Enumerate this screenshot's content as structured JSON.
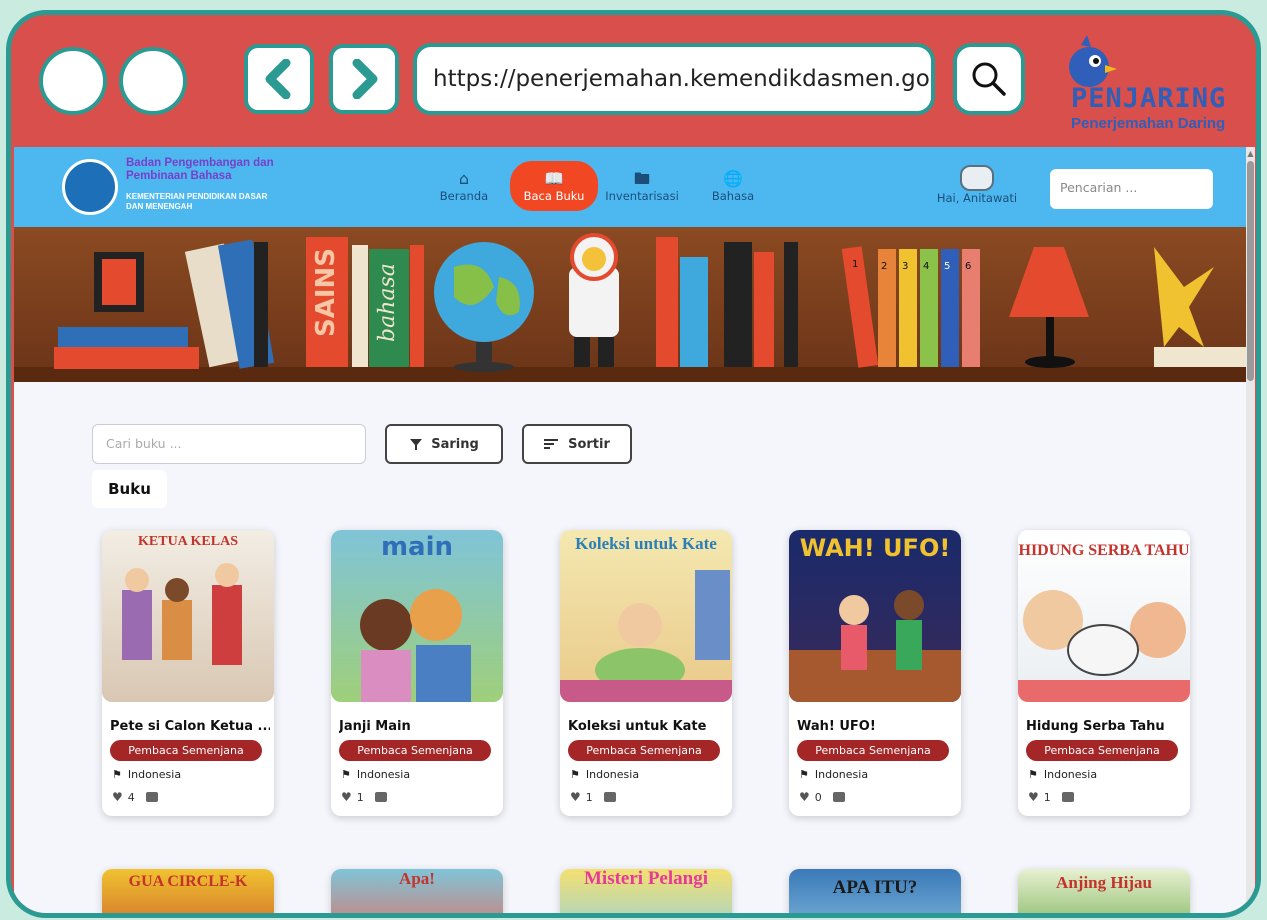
{
  "browser": {
    "url": "https://penerjemahan.kemendikdasmen.go.id/",
    "logo_title": "PENJARING",
    "logo_subtitle": "Penerjemahan Daring"
  },
  "site": {
    "org_line1": "Badan Pengembangan dan Pembinaan Bahasa",
    "org_line2": "KEMENTERIAN PENDIDIKAN DASAR DAN MENENGAH",
    "nav": [
      {
        "label": "Beranda",
        "icon": "home-icon"
      },
      {
        "label": "Baca Buku",
        "icon": "book-open-icon"
      },
      {
        "label": "Inventarisasi",
        "icon": "folder-icon"
      },
      {
        "label": "Bahasa",
        "icon": "globe-icon"
      }
    ],
    "greeting": "Hai, Anitawati",
    "search_placeholder": "Pencarian ..."
  },
  "catalog": {
    "search_placeholder": "Cari buku ...",
    "filter_label": "Saring",
    "sort_label": "Sortir",
    "tab_label": "Buku",
    "books": [
      {
        "title": "Pete si Calon Ketua ...",
        "level": "Pembaca Semenjana",
        "language": "Indonesia",
        "likes": "4",
        "cover_text": "KETUA KELAS"
      },
      {
        "title": "Janji Main",
        "level": "Pembaca Semenjana",
        "language": "Indonesia",
        "likes": "1",
        "cover_text": "main"
      },
      {
        "title": "Koleksi untuk Kate",
        "level": "Pembaca Semenjana",
        "language": "Indonesia",
        "likes": "1",
        "cover_text": "Koleksi untuk Kate"
      },
      {
        "title": "Wah! UFO!",
        "level": "Pembaca Semenjana",
        "language": "Indonesia",
        "likes": "0",
        "cover_text": "WAH! UFO!"
      },
      {
        "title": "Hidung Serba Tahu",
        "level": "Pembaca Semenjana",
        "language": "Indonesia",
        "likes": "1",
        "cover_text": "HIDUNG SERBA TAHU"
      }
    ],
    "next_row_covers": [
      {
        "cover_text": "GUA CIRCLE-K"
      },
      {
        "cover_text": "Apa!"
      },
      {
        "cover_text": "Misteri Pelangi"
      },
      {
        "cover_text": "APA ITU?"
      },
      {
        "cover_text": "Anjing Hijau"
      }
    ]
  },
  "banner_labels": {
    "book1": "SAINS",
    "book2": "bahasa",
    "numbers": [
      "1",
      "2",
      "3",
      "4",
      "5",
      "6"
    ]
  },
  "colors": {
    "frame": "#d94f4c",
    "border": "#2a9a92",
    "header": "#4db8f0",
    "active_nav": "#f14722",
    "badge": "#a52627"
  }
}
